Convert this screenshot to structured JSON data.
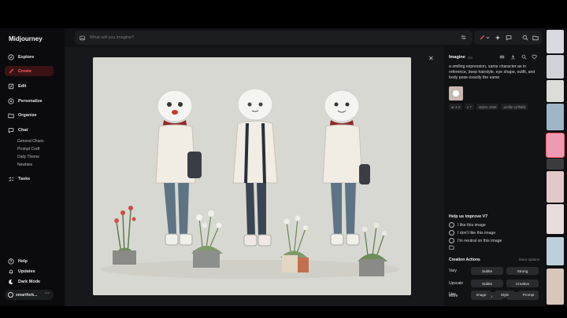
{
  "app": {
    "name": "Midjourney"
  },
  "sidebar": {
    "items": [
      {
        "label": "Explore",
        "icon": "compass-icon"
      },
      {
        "label": "Create",
        "icon": "brush-icon",
        "active": true
      },
      {
        "label": "Edit",
        "icon": "pencil-icon"
      },
      {
        "label": "Personalize",
        "icon": "sliders-icon"
      },
      {
        "label": "Organize",
        "icon": "folder-icon"
      },
      {
        "label": "Chat",
        "icon": "chat-icon"
      }
    ],
    "chat_rooms": [
      "General Chaos",
      "Prompt Craft",
      "Daily Theme",
      "Newbies"
    ],
    "tasks_label": "Tasks",
    "bottom": [
      {
        "label": "Help",
        "icon": "help-icon"
      },
      {
        "label": "Updates",
        "icon": "bell-icon"
      },
      {
        "label": "Dark Mode",
        "icon": "moon-icon"
      }
    ],
    "user": "smartfork..."
  },
  "search": {
    "placeholder": "What will you imagine?"
  },
  "detail": {
    "title": "Imagine",
    "time": "5m",
    "prompt": "a smiling expression, same character as in reference, keep hairstyle, eye shape, outfit, and body pose exactly the same",
    "tags": [
      "ar 4:3",
      "v 7",
      "stylize 1000",
      "profile ej7f8kfd"
    ],
    "feedback": {
      "title": "Help us improve V7",
      "options": [
        "I like this image",
        "I don't like this image",
        "I'm neutral on this image"
      ]
    },
    "creation_actions": {
      "title": "Creation Actions",
      "more": "More options",
      "rows": [
        {
          "label": "Vary",
          "buttons": [
            "Subtle",
            "Strong"
          ]
        },
        {
          "label": "Upscale",
          "buttons": [
            "Subtle",
            "Creative"
          ]
        },
        {
          "label": "More",
          "buttons": [
            "Rerun",
            "Edit"
          ]
        },
        {
          "label": "Use",
          "buttons": [
            "Image",
            "Style",
            "Prompt"
          ]
        }
      ]
    }
  },
  "colors": {
    "accent": "#ff5a5f",
    "sidebar_bg": "#0b0b0d",
    "panel_bg": "#111214"
  }
}
